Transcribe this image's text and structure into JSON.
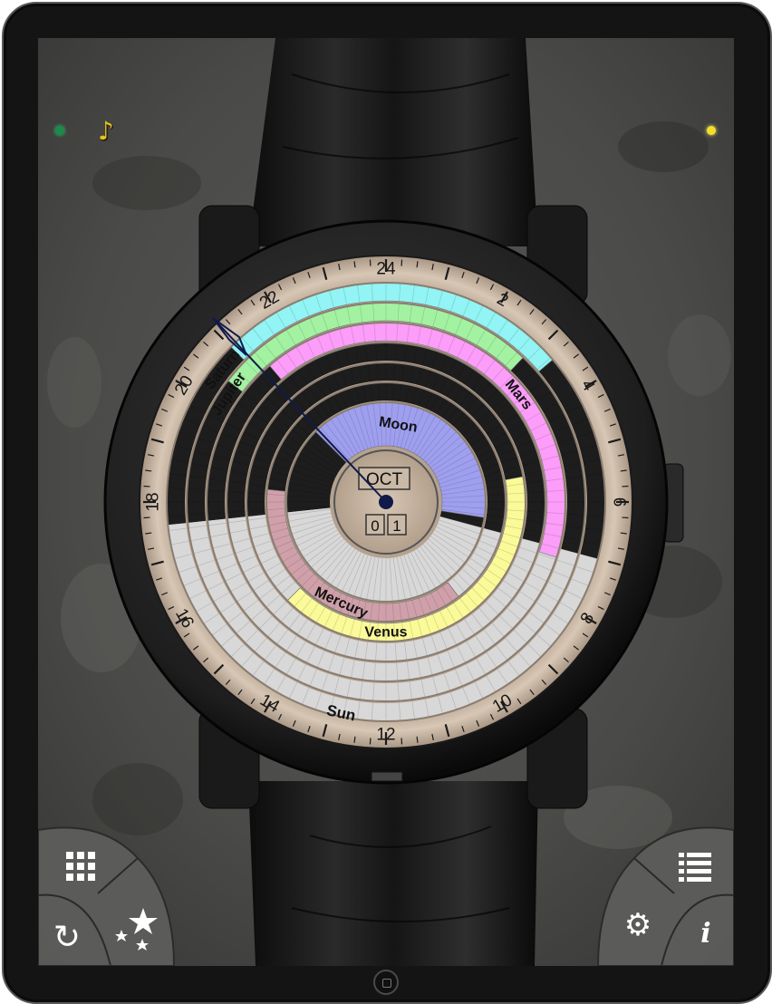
{
  "status": {
    "left_dot_color": "#1d8a4a",
    "right_dot_color": "#f5dd2a",
    "music_icon": "music-note-icon"
  },
  "dial": {
    "hour_labels": [
      "24",
      "2",
      "4",
      "6",
      "8",
      "10",
      "12",
      "14",
      "16",
      "18",
      "20",
      "22"
    ],
    "month": "OCT",
    "day_digits": [
      "0",
      "1"
    ]
  },
  "planets": {
    "moon": "Moon",
    "mercury": "Mercury",
    "venus": "Venus",
    "mars": "Mars",
    "jupiter": "Jupiter",
    "saturn": "Saturn",
    "sun": "Sun"
  },
  "colors": {
    "moon": "#9f9ff0",
    "mercury": "#d0a0aa",
    "venus": "#fafa98",
    "mars": "#fc9dfa",
    "jupiter": "#a2f2a2",
    "saturn": "#92f4f4",
    "night": "#1d1d1d",
    "daylight": "#d8d8d8",
    "bezel": "#c8b4a0"
  },
  "controls": {
    "grid": "grid-icon",
    "refresh": "refresh-icon",
    "favorites": "stars-icon",
    "list": "list-icon",
    "settings": "gear-icon",
    "info": "i"
  }
}
